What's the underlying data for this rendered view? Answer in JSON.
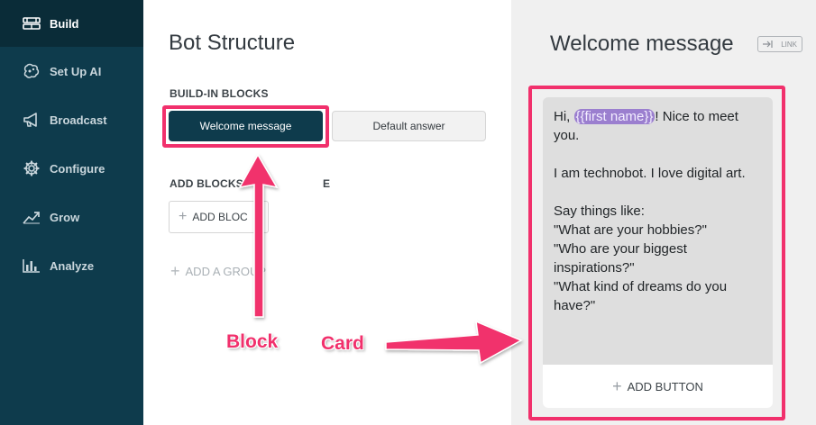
{
  "sidebar": {
    "items": [
      {
        "label": "Build",
        "icon": "build-icon",
        "active": true
      },
      {
        "label": "Set Up AI",
        "icon": "ai-brain-icon",
        "active": false
      },
      {
        "label": "Broadcast",
        "icon": "megaphone-icon",
        "active": false
      },
      {
        "label": "Configure",
        "icon": "gear-icon",
        "active": false
      },
      {
        "label": "Grow",
        "icon": "trend-up-icon",
        "active": false
      },
      {
        "label": "Analyze",
        "icon": "bar-chart-icon",
        "active": false
      }
    ]
  },
  "bot_structure": {
    "title": "Bot Structure",
    "built_in_label": "BUILD-IN BLOCKS",
    "welcome_block": "Welcome message",
    "default_block": "Default answer",
    "add_blocks_label": "ADD BLOCKS",
    "add_blocks_label_tail": "E",
    "add_block_button": "ADD BLOC",
    "add_group": "ADD A GROUP"
  },
  "editor": {
    "title": "Welcome message",
    "link_button": "LINK",
    "card": {
      "text_before": "Hi, ",
      "variable_chip": "{{first name}}",
      "text_after": "! Nice to meet you.\n\nI am technobot. I love digital art.\n\nSay things like:\n\"What are your hobbies?\"\n\"Who are your biggest inspirations?\"\n\"What kind of dreams do you have?\"",
      "add_button": "ADD BUTTON"
    }
  },
  "annotations": {
    "block_label": "Block",
    "card_label": "Card",
    "color": "#f1306c"
  },
  "colors": {
    "sidebar_bg": "#0e3b4c",
    "sidebar_active": "#0a2c38",
    "accent": "#f1306c",
    "chip": "#9b7fcf"
  }
}
